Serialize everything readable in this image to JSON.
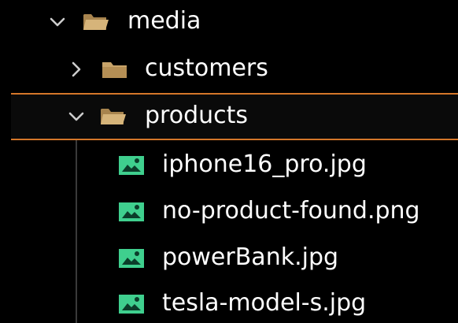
{
  "explorer": {
    "folders": [
      {
        "name": "media",
        "expanded": true,
        "icon": "folder-open-icon"
      },
      {
        "name": "customers",
        "expanded": false,
        "icon": "folder-closed-icon"
      },
      {
        "name": "products",
        "expanded": true,
        "icon": "folder-open-icon",
        "selected": true
      }
    ],
    "files": [
      {
        "name": "iphone16_pro.jpg",
        "icon": "image-file-icon"
      },
      {
        "name": "no-product-found.png",
        "icon": "image-file-icon"
      },
      {
        "name": "powerBank.jpg",
        "icon": "image-file-icon"
      },
      {
        "name": "tesla-model-s.jpg",
        "icon": "image-file-icon"
      }
    ]
  },
  "colors": {
    "background": "#000000",
    "folder": "#c8a46a",
    "image_icon": "#3fcf8e",
    "selection_border": "#d4762a",
    "chevron": "#cccccc"
  }
}
